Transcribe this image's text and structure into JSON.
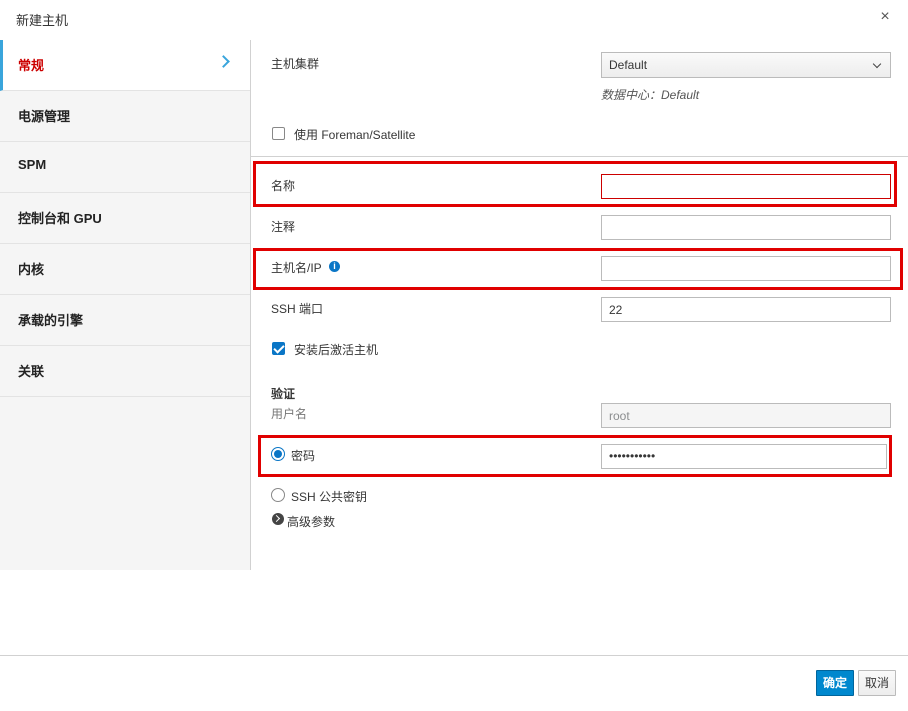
{
  "dialog": {
    "title": "新建主机",
    "close_glyph": "×"
  },
  "sidebar": {
    "items": [
      {
        "label": "常规"
      },
      {
        "label": "电源管理"
      },
      {
        "label": "SPM"
      },
      {
        "label": "控制台和 GPU"
      },
      {
        "label": "内核"
      },
      {
        "label": "承载的引擎"
      },
      {
        "label": "关联"
      }
    ]
  },
  "form": {
    "cluster": {
      "label": "主机集群",
      "value": "Default",
      "hint": "数据中心：Default"
    },
    "foreman": {
      "label": "使用 Foreman/Satellite",
      "checked": false
    },
    "name": {
      "label": "名称",
      "value": ""
    },
    "comment": {
      "label": "注释",
      "value": ""
    },
    "hostname": {
      "label": "主机名/IP",
      "value": "",
      "info_glyph": "i"
    },
    "ssh_port": {
      "label": "SSH 端口",
      "value": "22"
    },
    "activate": {
      "label": "安装后激活主机",
      "checked": true
    },
    "auth": {
      "title": "验证",
      "username_label": "用户名",
      "username": "root",
      "password_label": "密码",
      "password": "•••••••••••",
      "ssh_key_label": "SSH 公共密钥"
    },
    "advanced_label": "高级参数"
  },
  "footer": {
    "ok_label": "确定",
    "cancel_label": "取消"
  },
  "colors": {
    "accent": "#0088ce",
    "error": "#cc0000",
    "highlight": "#e00000",
    "active_nav_text": "#cc0000"
  }
}
